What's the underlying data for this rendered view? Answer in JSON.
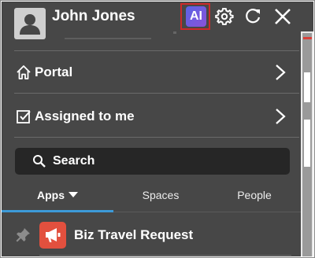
{
  "header": {
    "user_name": "John Jones",
    "ai_label": "AI",
    "icons": [
      "user-avatar-icon",
      "settings-gear-icon",
      "refresh-icon",
      "close-icon"
    ]
  },
  "nav": {
    "portal": {
      "label": "Portal",
      "icon": "home-icon"
    },
    "assigned": {
      "label": "Assigned to me",
      "icon": "checkbox-icon"
    }
  },
  "search": {
    "label": "Search",
    "icon": "search-icon"
  },
  "tabs": {
    "apps": "Apps",
    "spaces": "Spaces",
    "people": "People",
    "active": "Apps"
  },
  "apps": [
    {
      "label": "Biz Travel Request",
      "icon": "megaphone-icon",
      "pinned_icon": "pin-icon"
    }
  ],
  "colors": {
    "panel_bg": "#474747",
    "search_bg": "#262626",
    "ai_gradient_start": "#5a63e6",
    "ai_gradient_end": "#8a52d8",
    "highlight_border": "#cc2a2a",
    "active_tab_underline": "#3d9ad8",
    "app_icon_bg": "#e2503e"
  }
}
